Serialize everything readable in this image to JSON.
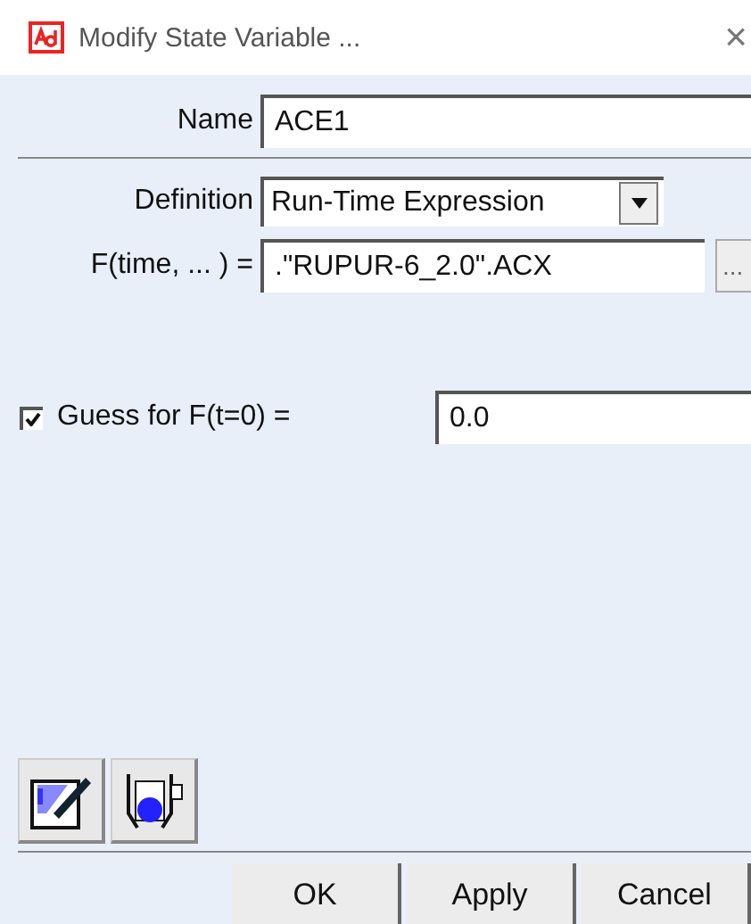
{
  "window": {
    "title": "Modify State Variable ...",
    "close": "×"
  },
  "name": {
    "label": "Name",
    "value": "ACE1"
  },
  "definition": {
    "label": "Definition",
    "value": "Run-Time Expression"
  },
  "function": {
    "label": "F(time, ... ) =",
    "value": ".\"RUPUR-6_2.0\".ACX",
    "browse": "..."
  },
  "guess": {
    "label": "Guess for F(t=0) =",
    "checked": true,
    "value": "0.0"
  },
  "buttons": [
    "OK",
    "Apply",
    "Cancel"
  ]
}
